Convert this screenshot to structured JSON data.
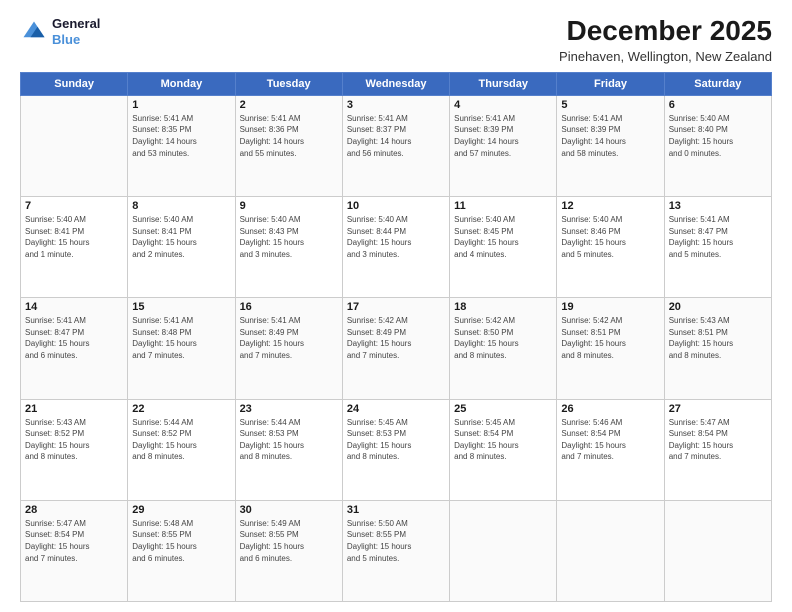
{
  "header": {
    "logo_line1": "General",
    "logo_line2": "Blue",
    "title": "December 2025",
    "subtitle": "Pinehaven, Wellington, New Zealand"
  },
  "days_of_week": [
    "Sunday",
    "Monday",
    "Tuesday",
    "Wednesday",
    "Thursday",
    "Friday",
    "Saturday"
  ],
  "weeks": [
    [
      {
        "day": "",
        "info": ""
      },
      {
        "day": "1",
        "info": "Sunrise: 5:41 AM\nSunset: 8:35 PM\nDaylight: 14 hours\nand 53 minutes."
      },
      {
        "day": "2",
        "info": "Sunrise: 5:41 AM\nSunset: 8:36 PM\nDaylight: 14 hours\nand 55 minutes."
      },
      {
        "day": "3",
        "info": "Sunrise: 5:41 AM\nSunset: 8:37 PM\nDaylight: 14 hours\nand 56 minutes."
      },
      {
        "day": "4",
        "info": "Sunrise: 5:41 AM\nSunset: 8:39 PM\nDaylight: 14 hours\nand 57 minutes."
      },
      {
        "day": "5",
        "info": "Sunrise: 5:41 AM\nSunset: 8:39 PM\nDaylight: 14 hours\nand 58 minutes."
      },
      {
        "day": "6",
        "info": "Sunrise: 5:40 AM\nSunset: 8:40 PM\nDaylight: 15 hours\nand 0 minutes."
      }
    ],
    [
      {
        "day": "7",
        "info": "Sunrise: 5:40 AM\nSunset: 8:41 PM\nDaylight: 15 hours\nand 1 minute."
      },
      {
        "day": "8",
        "info": "Sunrise: 5:40 AM\nSunset: 8:41 PM\nDaylight: 15 hours\nand 2 minutes."
      },
      {
        "day": "9",
        "info": "Sunrise: 5:40 AM\nSunset: 8:43 PM\nDaylight: 15 hours\nand 3 minutes."
      },
      {
        "day": "10",
        "info": "Sunrise: 5:40 AM\nSunset: 8:44 PM\nDaylight: 15 hours\nand 3 minutes."
      },
      {
        "day": "11",
        "info": "Sunrise: 5:40 AM\nSunset: 8:45 PM\nDaylight: 15 hours\nand 4 minutes."
      },
      {
        "day": "12",
        "info": "Sunrise: 5:40 AM\nSunset: 8:46 PM\nDaylight: 15 hours\nand 5 minutes."
      },
      {
        "day": "13",
        "info": "Sunrise: 5:41 AM\nSunset: 8:47 PM\nDaylight: 15 hours\nand 5 minutes."
      }
    ],
    [
      {
        "day": "14",
        "info": "Sunrise: 5:41 AM\nSunset: 8:47 PM\nDaylight: 15 hours\nand 6 minutes."
      },
      {
        "day": "15",
        "info": "Sunrise: 5:41 AM\nSunset: 8:48 PM\nDaylight: 15 hours\nand 7 minutes."
      },
      {
        "day": "16",
        "info": "Sunrise: 5:41 AM\nSunset: 8:49 PM\nDaylight: 15 hours\nand 7 minutes."
      },
      {
        "day": "17",
        "info": "Sunrise: 5:42 AM\nSunset: 8:49 PM\nDaylight: 15 hours\nand 7 minutes."
      },
      {
        "day": "18",
        "info": "Sunrise: 5:42 AM\nSunset: 8:50 PM\nDaylight: 15 hours\nand 8 minutes."
      },
      {
        "day": "19",
        "info": "Sunrise: 5:42 AM\nSunset: 8:51 PM\nDaylight: 15 hours\nand 8 minutes."
      },
      {
        "day": "20",
        "info": "Sunrise: 5:43 AM\nSunset: 8:51 PM\nDaylight: 15 hours\nand 8 minutes."
      }
    ],
    [
      {
        "day": "21",
        "info": "Sunrise: 5:43 AM\nSunset: 8:52 PM\nDaylight: 15 hours\nand 8 minutes."
      },
      {
        "day": "22",
        "info": "Sunrise: 5:44 AM\nSunset: 8:52 PM\nDaylight: 15 hours\nand 8 minutes."
      },
      {
        "day": "23",
        "info": "Sunrise: 5:44 AM\nSunset: 8:53 PM\nDaylight: 15 hours\nand 8 minutes."
      },
      {
        "day": "24",
        "info": "Sunrise: 5:45 AM\nSunset: 8:53 PM\nDaylight: 15 hours\nand 8 minutes."
      },
      {
        "day": "25",
        "info": "Sunrise: 5:45 AM\nSunset: 8:54 PM\nDaylight: 15 hours\nand 8 minutes."
      },
      {
        "day": "26",
        "info": "Sunrise: 5:46 AM\nSunset: 8:54 PM\nDaylight: 15 hours\nand 7 minutes."
      },
      {
        "day": "27",
        "info": "Sunrise: 5:47 AM\nSunset: 8:54 PM\nDaylight: 15 hours\nand 7 minutes."
      }
    ],
    [
      {
        "day": "28",
        "info": "Sunrise: 5:47 AM\nSunset: 8:54 PM\nDaylight: 15 hours\nand 7 minutes."
      },
      {
        "day": "29",
        "info": "Sunrise: 5:48 AM\nSunset: 8:55 PM\nDaylight: 15 hours\nand 6 minutes."
      },
      {
        "day": "30",
        "info": "Sunrise: 5:49 AM\nSunset: 8:55 PM\nDaylight: 15 hours\nand 6 minutes."
      },
      {
        "day": "31",
        "info": "Sunrise: 5:50 AM\nSunset: 8:55 PM\nDaylight: 15 hours\nand 5 minutes."
      },
      {
        "day": "",
        "info": ""
      },
      {
        "day": "",
        "info": ""
      },
      {
        "day": "",
        "info": ""
      }
    ]
  ]
}
